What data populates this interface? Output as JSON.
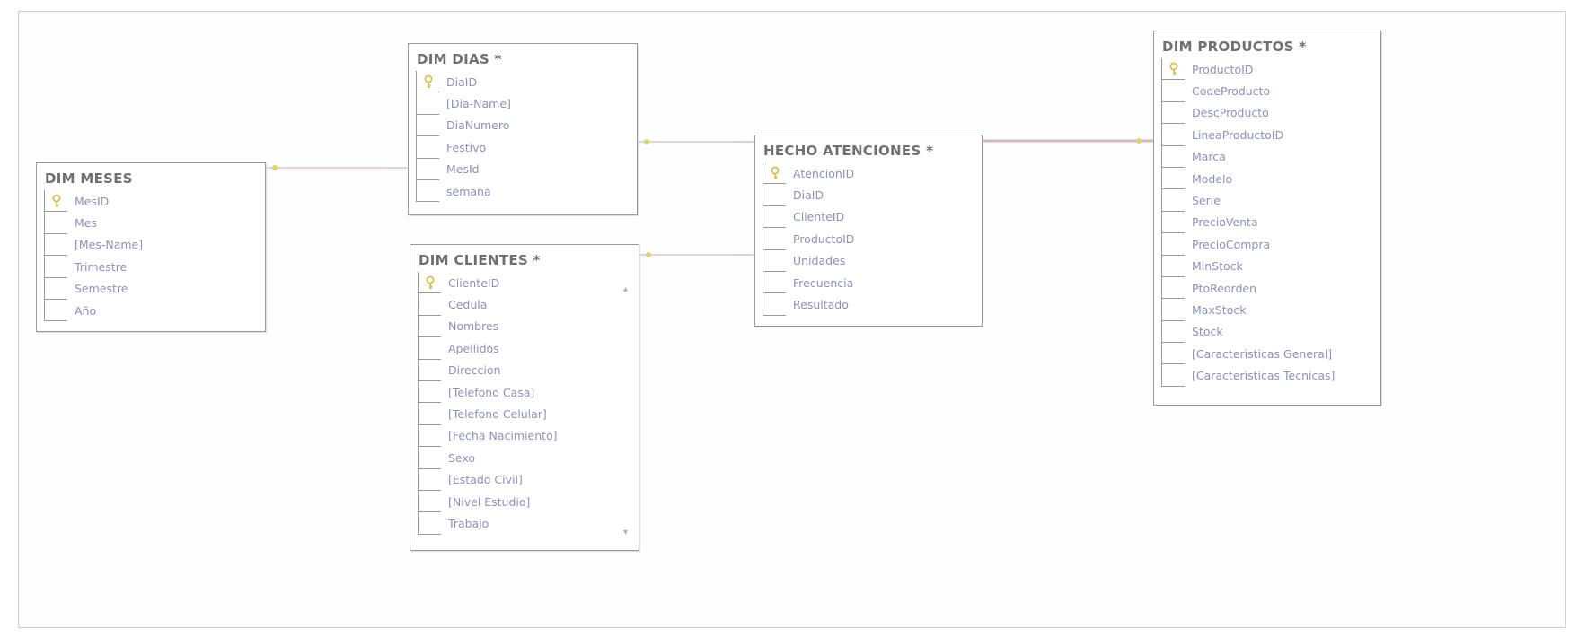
{
  "tables": {
    "meses": {
      "title": "DIM MESES",
      "columns": [
        "MesID",
        "Mes",
        "[Mes-Name]",
        "Trimestre",
        "Semestre",
        "Año"
      ]
    },
    "dias": {
      "title": "DIM DIAS *",
      "columns": [
        "DiaID",
        "[Dia-Name]",
        "DiaNumero",
        "Festivo",
        "MesId",
        "semana"
      ]
    },
    "clientes": {
      "title": "DIM CLIENTES *",
      "columns": [
        "ClienteID",
        "Cedula",
        "Nombres",
        "Apellidos",
        "Direccion",
        "[Telefono Casa]",
        "[Telefono Celular]",
        "[Fecha Nacimiento]",
        "Sexo",
        "[Estado Civil]",
        "[Nivel Estudio]",
        "Trabajo"
      ]
    },
    "hechos": {
      "title": "HECHO ATENCIONES *",
      "columns": [
        "AtencionID",
        "DiaID",
        "ClienteID",
        "ProductoID",
        "Unidades",
        "Frecuencia",
        "Resultado"
      ]
    },
    "productos": {
      "title": "DIM PRODUCTOS *",
      "columns": [
        "ProductoID",
        "CodeProducto",
        "DescProducto",
        "LineaProductoID",
        "Marca",
        "Modelo",
        "Serie",
        "PrecioVenta",
        "PrecioCompra",
        "MinStock",
        "PtoReorden",
        "MaxStock",
        "Stock",
        "[Caracteristicas General]",
        "[Caracteristicas Tecnicas]"
      ]
    }
  },
  "relationships": [
    {
      "from": "DIM MESES",
      "to": "DIM DIAS *"
    },
    {
      "from": "DIM DIAS *",
      "to": "HECHO ATENCIONES *"
    },
    {
      "from": "DIM CLIENTES *",
      "to": "HECHO ATENCIONES *"
    },
    {
      "from": "DIM PRODUCTOS *",
      "to": "HECHO ATENCIONES *"
    }
  ],
  "colors": {
    "key_icon": "#d9b83a",
    "relationship_line": "#e2c8c8",
    "key_end": "#e0d46a"
  },
  "icons": {
    "primary_key": "key-icon"
  }
}
